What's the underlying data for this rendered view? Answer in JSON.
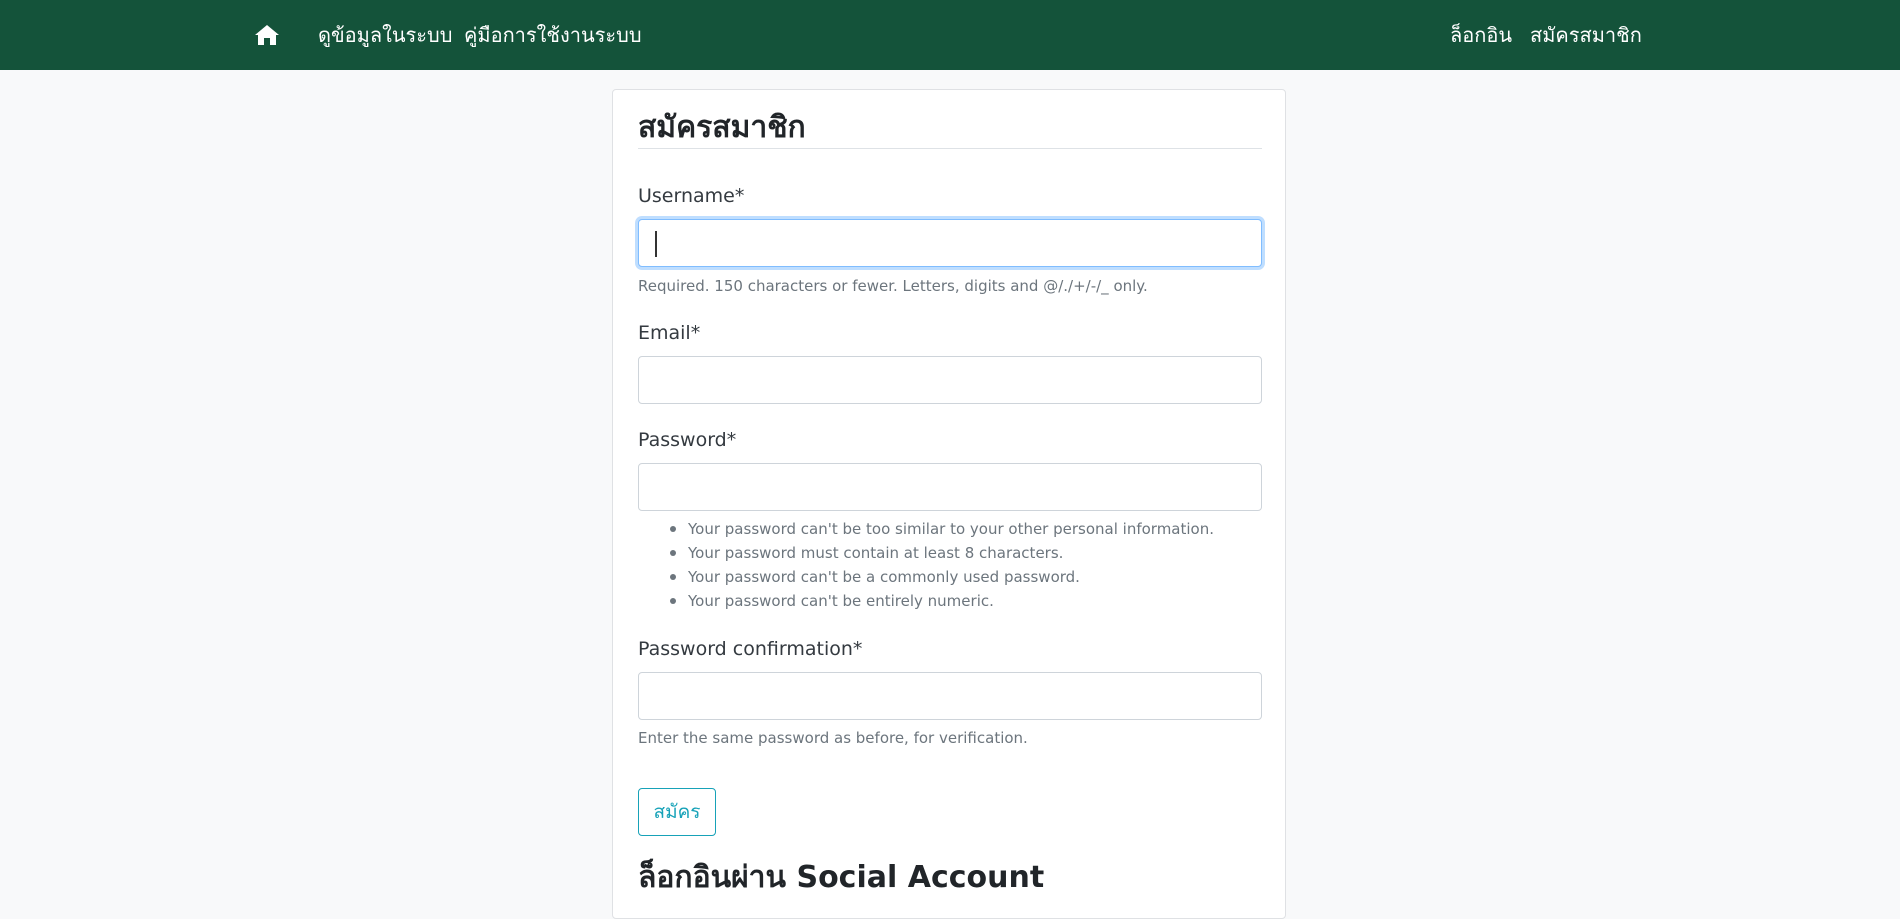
{
  "navbar": {
    "home_icon": "home-icon",
    "links_left": [
      "ดูข้อมูลในระบบ",
      "คู่มือการใช้งานระบบ"
    ],
    "links_right": [
      "ล็อกอิน",
      "สมัครสมาชิก"
    ],
    "background": "#14533a"
  },
  "form": {
    "title": "สมัครสมาชิก",
    "fields": {
      "username": {
        "label": "Username*",
        "value": "",
        "help": "Required. 150 characters or fewer. Letters, digits and @/./+/-/_ only."
      },
      "email": {
        "label": "Email*",
        "value": ""
      },
      "password": {
        "label": "Password*",
        "value": "",
        "rules": [
          "Your password can't be too similar to your other personal information.",
          "Your password must contain at least 8 characters.",
          "Your password can't be a commonly used password.",
          "Your password can't be entirely numeric."
        ]
      },
      "password_confirmation": {
        "label": "Password confirmation*",
        "value": "",
        "help": "Enter the same password as before, for verification."
      }
    },
    "submit_label": "สมัคร",
    "accent_color": "#17a2b8"
  },
  "social": {
    "title": "ล็อกอินผ่าน Social Account"
  }
}
